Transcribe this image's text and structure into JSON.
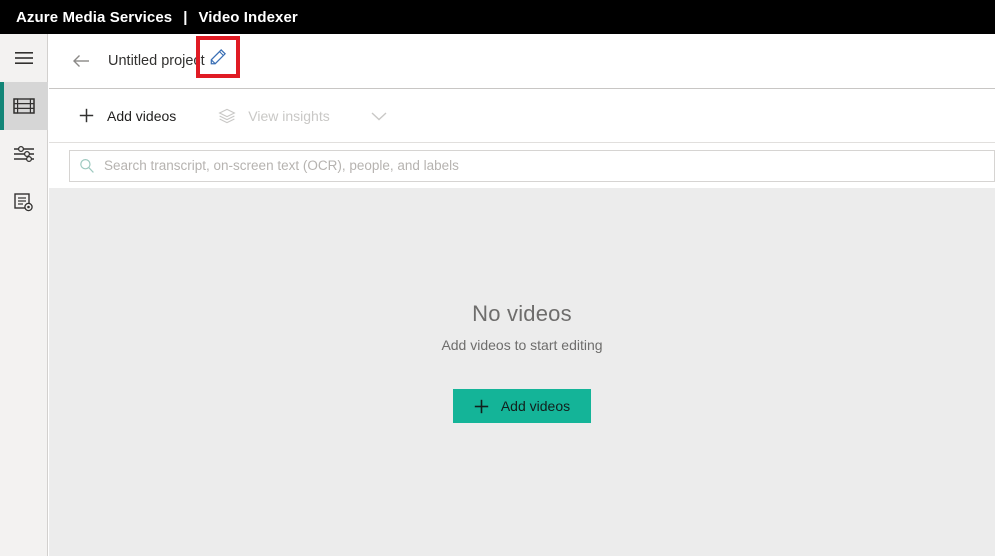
{
  "topbar": {
    "brand_primary": "Azure Media Services",
    "separator": "|",
    "brand_secondary": "Video Indexer",
    "background": "#000000",
    "text_color": "#ffffff"
  },
  "rail": {
    "items": [
      {
        "icon": "hamburger-menu-icon",
        "name": "menu",
        "selected": false
      },
      {
        "icon": "film-strip-icon",
        "name": "projects",
        "selected": true
      },
      {
        "icon": "sliders-settings-icon",
        "name": "customization",
        "selected": false
      },
      {
        "icon": "document-gear-icon",
        "name": "model-settings",
        "selected": false
      }
    ],
    "selected_indicator_color": "#128577",
    "selected_background": "#d6d6d6",
    "background": "#f3f2f1"
  },
  "header": {
    "back_icon": "arrow-left-icon",
    "project_title": "Untitled project",
    "edit_icon": "pencil-edit-icon",
    "annotation_color": "#e01b24"
  },
  "toolbar": {
    "add_videos_label": "Add videos",
    "add_videos_icon": "plus-icon",
    "view_insights_label": "View insights",
    "view_insights_icon": "layers-stack-icon",
    "view_insights_disabled": true,
    "chevron_icon": "chevron-down-icon"
  },
  "search": {
    "placeholder": "Search transcript, on-screen text (OCR), people, and labels",
    "value": "",
    "icon": "search-magnifier-icon"
  },
  "empty_state": {
    "title": "No videos",
    "subtitle": "Add videos to start editing",
    "button_label": "Add videos",
    "button_icon": "plus-icon",
    "button_color": "#14b498",
    "background": "#ececec"
  }
}
